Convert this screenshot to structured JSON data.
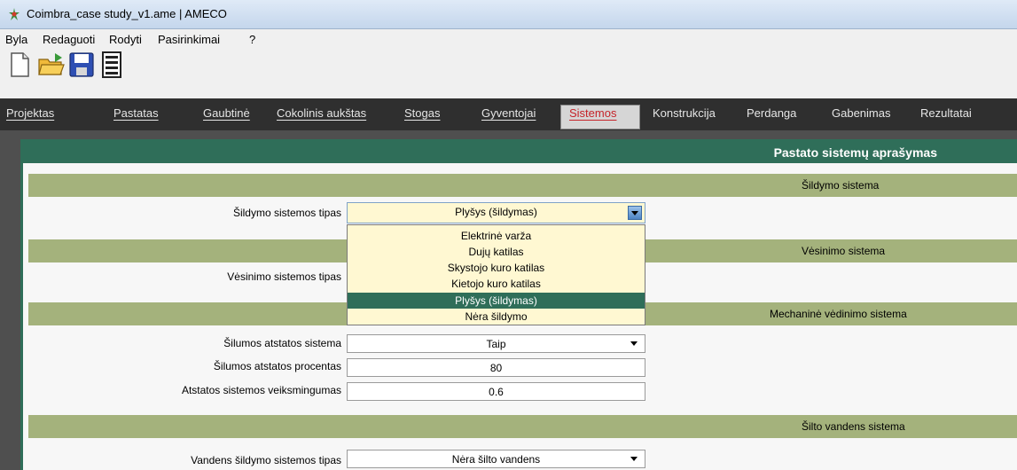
{
  "window": {
    "title": "Coimbra_case study_v1.ame | AMECO"
  },
  "menu": [
    "Byla",
    "Redaguoti",
    "Rodyti",
    "Pasirinkimai",
    "?"
  ],
  "toolbar": {
    "icons": [
      "new-file-icon",
      "open-folder-icon",
      "save-icon",
      "document-list-icon"
    ]
  },
  "tabs": [
    {
      "label": "Projektas"
    },
    {
      "label": "Pastatas"
    },
    {
      "label": "Gaubtinė"
    },
    {
      "label": "Cokolinis aukštas"
    },
    {
      "label": "Stogas"
    },
    {
      "label": "Gyventojai"
    },
    {
      "label": "Sistemos",
      "active": true
    },
    {
      "label": "Konstrukcija"
    },
    {
      "label": "Perdanga"
    },
    {
      "label": "Gabenimas"
    },
    {
      "label": "Rezultatai"
    }
  ],
  "panel": {
    "title": "Pastato sistemų aprašymas"
  },
  "sections": {
    "heating": {
      "title": "Šildymo sistema",
      "type_label": "Šildymo sistemos tipas",
      "type_value": "Plyšys (šildymas)",
      "options": [
        "Elektrinė varža",
        "Dujų katilas",
        "Skystojo kuro katilas",
        "Kietojo kuro katilas",
        "Plyšys (šildymas)",
        "Nėra šildymo"
      ],
      "selected_index": 4
    },
    "cooling": {
      "title": "Vėsinimo sistema",
      "type_label": "Vėsinimo sistemos tipas"
    },
    "ventilation": {
      "title": "Mechaninė vėdinimo sistema",
      "recovery_label": "Šilumos atstatos sistema",
      "recovery_value": "Taip",
      "percent_label": "Šilumos atstatos procentas",
      "percent_value": "80",
      "efficiency_label": "Atstatos sistemos veiksmingumas",
      "efficiency_value": "0.6"
    },
    "hot_water": {
      "title": "Šilto vandens sistema",
      "type_label": "Vandens šildymo sistemos tipas",
      "type_value": "Nėra šilto vandens"
    }
  },
  "colors": {
    "accent": "#2f6e59",
    "section_bar": "#a4b27c",
    "combo_bg": "#fff8d2",
    "active_tab_text": "#c6242a"
  }
}
